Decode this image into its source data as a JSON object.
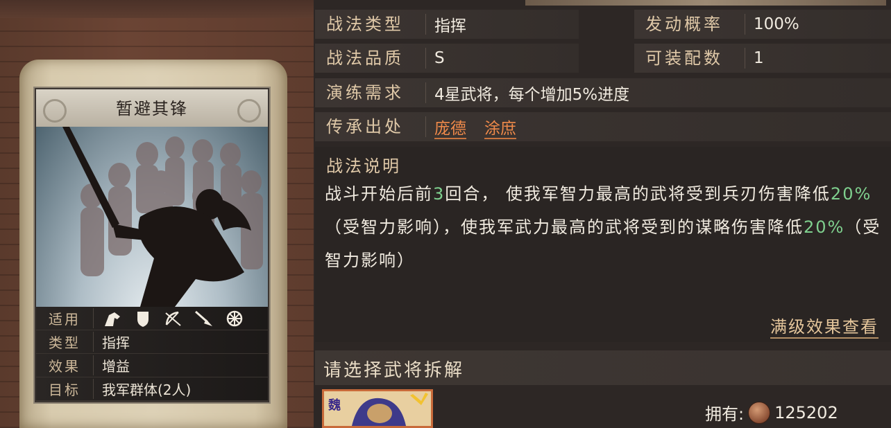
{
  "card": {
    "title": "暂避其锋",
    "rows": {
      "applicable_label": "适用",
      "type_label": "类型",
      "type_value": "指挥",
      "effect_label": "效果",
      "effect_value": "增益",
      "target_label": "目标",
      "target_value": "我军群体(2人)"
    },
    "unit_icons": [
      "cavalry-icon",
      "shield-icon",
      "bow-icon",
      "spear-icon",
      "wheel-icon"
    ]
  },
  "fields": {
    "type_label": "战法类型",
    "type_value": "指挥",
    "prob_label": "发动概率",
    "prob_value": "100%",
    "quality_label": "战法品质",
    "quality_value": "S",
    "slots_label": "可装配数",
    "slots_value": "1",
    "drill_label": "演练需求",
    "drill_value": "4星武将，每个增加5%进度",
    "origin_label": "传承出处",
    "origin_generals": [
      "庞德",
      "涂庶"
    ]
  },
  "description": {
    "title": "战法说明",
    "p1": "战斗开始后前",
    "n1": "3",
    "p2": "回合， 使我军智力最高的武将受到兵刃伤害降低",
    "n2": "20%",
    "p3": "（受智力影响），使我军武力最高的武将受到的谋略伤害降低",
    "n3": "20%",
    "p4": "（受智力影响）",
    "max_link": "满级效果查看"
  },
  "disassemble": {
    "title": "请选择武将拆解",
    "faction_char": "魏",
    "own_label": "拥有:",
    "own_value": "125202"
  },
  "colors": {
    "link": "#f08a4a",
    "highlight": "#7fd08e",
    "label": "#e0c9a8"
  }
}
